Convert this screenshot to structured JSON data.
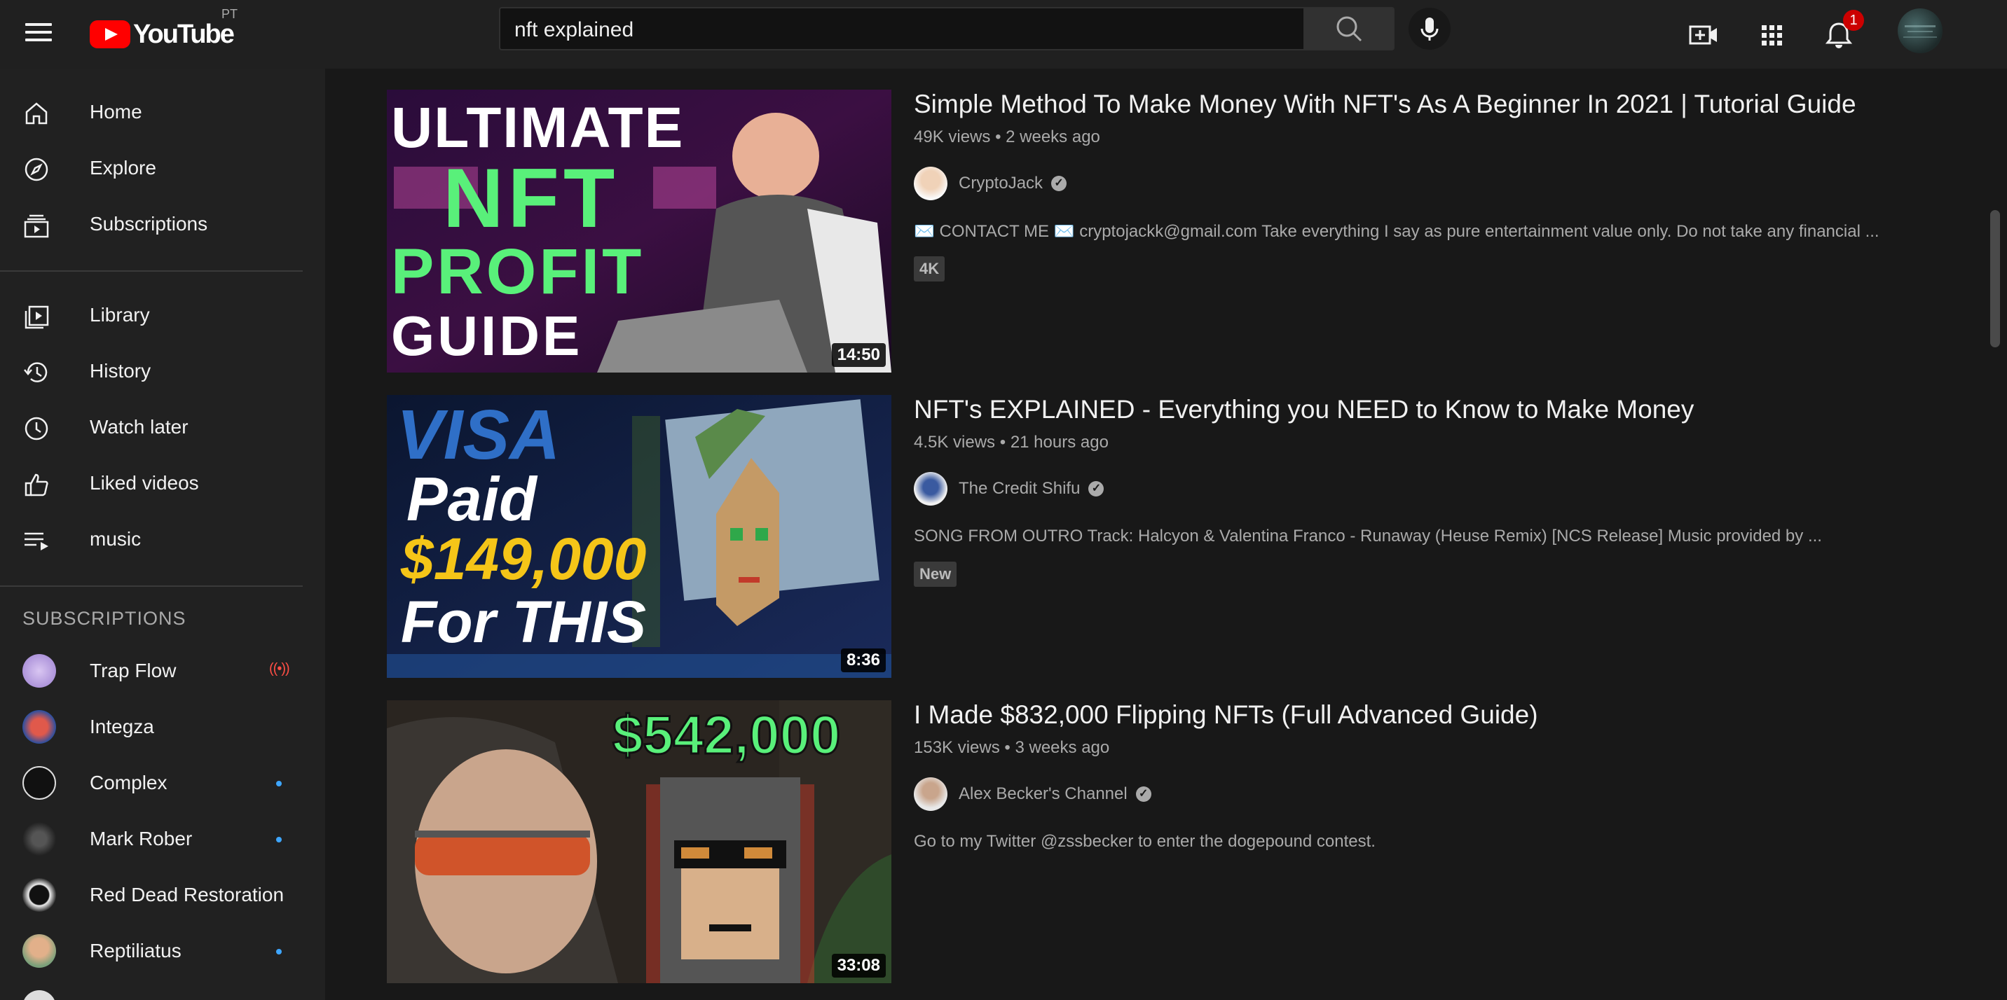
{
  "header": {
    "logo_text": "YouTube",
    "country_code": "PT",
    "search_value": "nft explained",
    "notification_count": "1"
  },
  "sidebar": {
    "main_items": [
      {
        "label": "Home",
        "icon": "home-icon"
      },
      {
        "label": "Explore",
        "icon": "compass-icon"
      },
      {
        "label": "Subscriptions",
        "icon": "subscriptions-icon"
      }
    ],
    "library_items": [
      {
        "label": "Library",
        "icon": "library-icon"
      },
      {
        "label": "History",
        "icon": "history-icon"
      },
      {
        "label": "Watch later",
        "icon": "clock-icon"
      },
      {
        "label": "Liked videos",
        "icon": "thumbs-up-icon"
      },
      {
        "label": "music",
        "icon": "playlist-icon"
      }
    ],
    "subscriptions_title": "SUBSCRIPTIONS",
    "subscriptions": [
      {
        "label": "Trap Flow",
        "indicator": "live"
      },
      {
        "label": "Integza",
        "indicator": "none"
      },
      {
        "label": "Complex",
        "indicator": "new"
      },
      {
        "label": "Mark Rober",
        "indicator": "new"
      },
      {
        "label": "Red Dead Restoration",
        "indicator": "none"
      },
      {
        "label": "Reptiliatus",
        "indicator": "new"
      }
    ]
  },
  "results": [
    {
      "title": "Simple Method To Make Money With NFT's As A Beginner In 2021 | Tutorial Guide",
      "views": "49K views",
      "age": "2 weeks ago",
      "channel": "CryptoJack",
      "description": "✉️ CONTACT ME ✉️ cryptojackk@gmail.com Take everything I say as pure entertainment value only. Do not take any financial ...",
      "badge": "4K",
      "duration": "14:50",
      "thumb_text": [
        "ULTIMATE",
        "NFT",
        "PROFIT",
        "GUIDE"
      ]
    },
    {
      "title": "NFT's EXPLAINED - Everything you NEED to Know to Make Money",
      "views": "4.5K views",
      "age": "21 hours ago",
      "channel": "The Credit Shifu",
      "description": "SONG FROM OUTRO Track: Halcyon & Valentina Franco - Runaway (Heuse Remix) [NCS Release] Music provided by ...",
      "badge": "New",
      "duration": "8:36",
      "thumb_text": [
        "VISA",
        "Paid",
        "$149,000",
        "For THIS"
      ]
    },
    {
      "title": "I Made $832,000 Flipping NFTs (Full Advanced Guide)",
      "views": "153K views",
      "age": "3 weeks ago",
      "channel": "Alex Becker's Channel",
      "description": "Go to my Twitter @zssbecker to enter the dogepound contest.",
      "badge": "",
      "duration": "33:08",
      "thumb_text": [
        "$542,000"
      ]
    }
  ],
  "colors": {
    "background": "#181818",
    "sidebar": "#212121",
    "header": "#202020",
    "brand_red": "#ff0000",
    "new_dot": "#3ea6ff"
  }
}
